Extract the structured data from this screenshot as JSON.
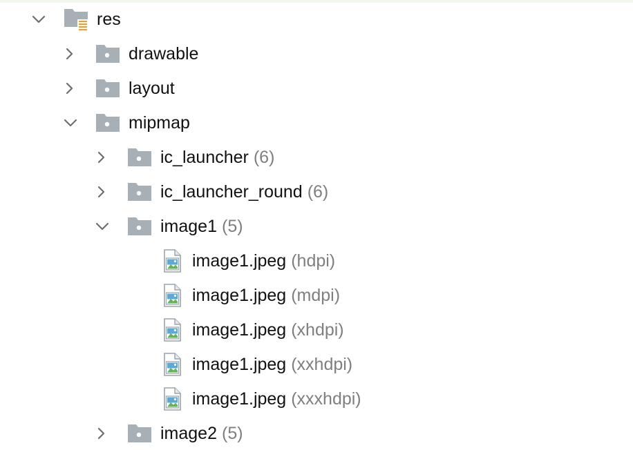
{
  "tree": {
    "nodes": [
      {
        "label": "res",
        "hint": "",
        "kind": "res-folder",
        "expanded": true,
        "level": 0
      },
      {
        "label": "drawable",
        "hint": "",
        "kind": "folder",
        "expanded": false,
        "level": 1
      },
      {
        "label": "layout",
        "hint": "",
        "kind": "folder",
        "expanded": false,
        "level": 1
      },
      {
        "label": "mipmap",
        "hint": "",
        "kind": "folder",
        "expanded": true,
        "level": 1
      },
      {
        "label": "ic_launcher",
        "hint": "(6)",
        "kind": "folder",
        "expanded": false,
        "level": 2
      },
      {
        "label": "ic_launcher_round",
        "hint": "(6)",
        "kind": "folder",
        "expanded": false,
        "level": 2
      },
      {
        "label": "image1",
        "hint": "(5)",
        "kind": "folder",
        "expanded": true,
        "level": 2
      },
      {
        "label": "image1.jpeg",
        "hint": "(hdpi)",
        "kind": "image-file",
        "expanded": null,
        "level": 3
      },
      {
        "label": "image1.jpeg",
        "hint": "(mdpi)",
        "kind": "image-file",
        "expanded": null,
        "level": 3
      },
      {
        "label": "image1.jpeg",
        "hint": "(xhdpi)",
        "kind": "image-file",
        "expanded": null,
        "level": 3
      },
      {
        "label": "image1.jpeg",
        "hint": "(xxhdpi)",
        "kind": "image-file",
        "expanded": null,
        "level": 3
      },
      {
        "label": "image1.jpeg",
        "hint": "(xxxhdpi)",
        "kind": "image-file",
        "expanded": null,
        "level": 3
      },
      {
        "label": "image2",
        "hint": "(5)",
        "kind": "folder",
        "expanded": false,
        "level": 2
      }
    ]
  },
  "colors": {
    "folder": "#a8b0b7",
    "chevron": "#6e6e6e",
    "text": "#111111",
    "hint": "#7f7f7f",
    "res_badge": "#d9a441",
    "image_sky": "#5fa8d3",
    "image_hill": "#67b35b"
  }
}
